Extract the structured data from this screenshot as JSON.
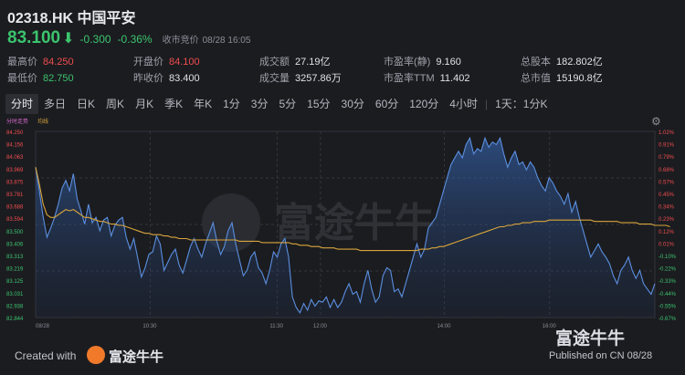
{
  "header": {
    "title": "02318.HK 中国平安",
    "price": "83.100",
    "arrow": "⬇",
    "change": "-0.300",
    "change_pct": "-0.36%",
    "status": "收市竞价",
    "time": "08/28 16:05"
  },
  "stats": [
    {
      "k": "最高价",
      "v": "84.250",
      "color": "red"
    },
    {
      "k": "开盘价",
      "v": "84.100",
      "color": "red"
    },
    {
      "k": "成交额",
      "v": "27.19亿",
      "color": "plain"
    },
    {
      "k": "市盈率(静)",
      "v": "9.160",
      "color": "plain"
    },
    {
      "k": "总股本",
      "v": "182.802亿",
      "color": "plain"
    },
    {
      "k": "最低价",
      "v": "82.750",
      "color": "green"
    },
    {
      "k": "昨收价",
      "v": "83.400",
      "color": "plain"
    },
    {
      "k": "成交量",
      "v": "3257.86万",
      "color": "plain"
    },
    {
      "k": "市盈率TTM",
      "v": "11.402",
      "color": "plain"
    },
    {
      "k": "总市值",
      "v": "15190.8亿",
      "color": "plain"
    }
  ],
  "tabs": [
    "分时",
    "多日",
    "日K",
    "周K",
    "月K",
    "季K",
    "年K",
    "1分",
    "3分",
    "5分",
    "15分",
    "30分",
    "60分",
    "120分",
    "4小时",
    "1天：1分K"
  ],
  "active_tab": 0,
  "chart_labels": {
    "legend_a": "分时走势",
    "legend_b": "均线"
  },
  "watermark": "富途牛牛",
  "footer": {
    "created": "Created with",
    "logo": "富途牛牛",
    "publish": "Published on CN 08/28"
  },
  "colors": {
    "up": "#ef4d4d",
    "down": "#3cc46e",
    "line": "#5b8fe0",
    "avg": "#d9a53b"
  },
  "chart_data": {
    "type": "line",
    "y_left_ticks": [
      "84.250",
      "84.156",
      "84.063",
      "83.969",
      "83.875",
      "83.781",
      "83.688",
      "83.594",
      "83.500",
      "83.406",
      "83.313",
      "83.219",
      "83.125",
      "83.031",
      "82.938",
      "82.844"
    ],
    "y_right_ticks": [
      "1.02%",
      "0.91%",
      "0.79%",
      "0.68%",
      "0.57%",
      "0.45%",
      "0.34%",
      "0.23%",
      "0.12%",
      "0.01%",
      "-0.10%",
      "-0.22%",
      "-0.33%",
      "-0.44%",
      "-0.55%",
      "-0.67%"
    ],
    "x_ticks": [
      "08/28",
      "10:30",
      "11:30",
      "12:00",
      "14:00",
      "16:00"
    ],
    "ylim": [
      82.844,
      84.25
    ],
    "price": [
      83.98,
      83.8,
      83.6,
      83.45,
      83.52,
      83.6,
      83.7,
      83.82,
      83.88,
      83.8,
      83.93,
      83.74,
      83.65,
      83.55,
      83.7,
      83.56,
      83.6,
      83.5,
      83.58,
      83.6,
      83.46,
      83.54,
      83.58,
      83.6,
      83.45,
      83.36,
      83.44,
      83.3,
      83.15,
      83.22,
      83.32,
      83.34,
      83.46,
      83.4,
      83.2,
      83.26,
      83.32,
      83.36,
      83.24,
      83.18,
      83.28,
      83.38,
      83.44,
      83.36,
      83.3,
      83.4,
      83.48,
      83.56,
      83.42,
      83.32,
      83.38,
      83.5,
      83.56,
      83.4,
      83.28,
      83.16,
      83.2,
      83.3,
      83.34,
      83.22,
      83.18,
      83.1,
      83.2,
      83.34,
      83.3,
      83.4,
      83.44,
      83.3,
      83.0,
      82.92,
      82.88,
      82.95,
      82.9,
      82.98,
      82.93,
      82.97,
      82.96,
      83.0,
      82.92,
      82.98,
      82.92,
      82.96,
      83.04,
      83.1,
      83.02,
      83.04,
      82.96,
      83.1,
      83.2,
      83.06,
      82.96,
      83.0,
      83.16,
      83.22,
      83.2,
      83.04,
      83.06,
      83.0,
      83.1,
      83.2,
      83.3,
      83.4,
      83.3,
      83.36,
      83.52,
      83.56,
      83.6,
      83.7,
      83.8,
      83.9,
      84.0,
      84.05,
      84.1,
      84.05,
      84.15,
      84.2,
      84.08,
      84.12,
      84.1,
      84.2,
      84.13,
      84.17,
      84.15,
      84.2,
      84.08,
      83.98,
      84.05,
      84.1,
      84.0,
      84.02,
      83.96,
      84.02,
      83.98,
      83.9,
      83.84,
      83.8,
      83.9,
      83.86,
      83.8,
      83.76,
      83.7,
      83.78,
      83.64,
      83.72,
      83.6,
      83.5,
      83.4,
      83.3,
      83.35,
      83.4,
      83.34,
      83.3,
      83.25,
      83.16,
      83.1,
      83.2,
      83.24,
      83.3,
      83.2,
      83.14,
      83.2,
      83.1,
      83.06,
      83.02,
      83.1
    ],
    "average": [
      83.98,
      83.85,
      83.7,
      83.62,
      83.6,
      83.6,
      83.62,
      83.64,
      83.66,
      83.65,
      83.66,
      83.64,
      83.62,
      83.6,
      83.6,
      83.59,
      83.58,
      83.57,
      83.57,
      83.56,
      83.55,
      83.55,
      83.54,
      83.54,
      83.53,
      83.52,
      83.51,
      83.5,
      83.49,
      83.48,
      83.48,
      83.47,
      83.47,
      83.47,
      83.46,
      83.46,
      83.45,
      83.45,
      83.44,
      83.44,
      83.44,
      83.43,
      83.43,
      83.43,
      83.43,
      83.43,
      83.43,
      83.43,
      83.43,
      83.43,
      83.43,
      83.43,
      83.43,
      83.43,
      83.42,
      83.42,
      83.42,
      83.42,
      83.42,
      83.42,
      83.41,
      83.41,
      83.41,
      83.41,
      83.41,
      83.41,
      83.41,
      83.41,
      83.4,
      83.4,
      83.39,
      83.39,
      83.39,
      83.38,
      83.38,
      83.38,
      83.37,
      83.37,
      83.37,
      83.37,
      83.36,
      83.36,
      83.36,
      83.36,
      83.36,
      83.36,
      83.35,
      83.35,
      83.35,
      83.35,
      83.35,
      83.35,
      83.35,
      83.35,
      83.35,
      83.35,
      83.35,
      83.35,
      83.35,
      83.35,
      83.35,
      83.35,
      83.36,
      83.36,
      83.36,
      83.37,
      83.37,
      83.38,
      83.38,
      83.39,
      83.4,
      83.41,
      83.42,
      83.43,
      83.44,
      83.45,
      83.46,
      83.47,
      83.48,
      83.49,
      83.5,
      83.51,
      83.52,
      83.53,
      83.53,
      83.54,
      83.54,
      83.55,
      83.55,
      83.56,
      83.56,
      83.56,
      83.57,
      83.57,
      83.57,
      83.57,
      83.58,
      83.58,
      83.58,
      83.58,
      83.58,
      83.58,
      83.58,
      83.58,
      83.58,
      83.58,
      83.58,
      83.58,
      83.57,
      83.57,
      83.57,
      83.57,
      83.57,
      83.57,
      83.57,
      83.56,
      83.56,
      83.56,
      83.56,
      83.56,
      83.55,
      83.55,
      83.55,
      83.55,
      83.54,
      83.54,
      83.54,
      83.54,
      83.53
    ]
  }
}
